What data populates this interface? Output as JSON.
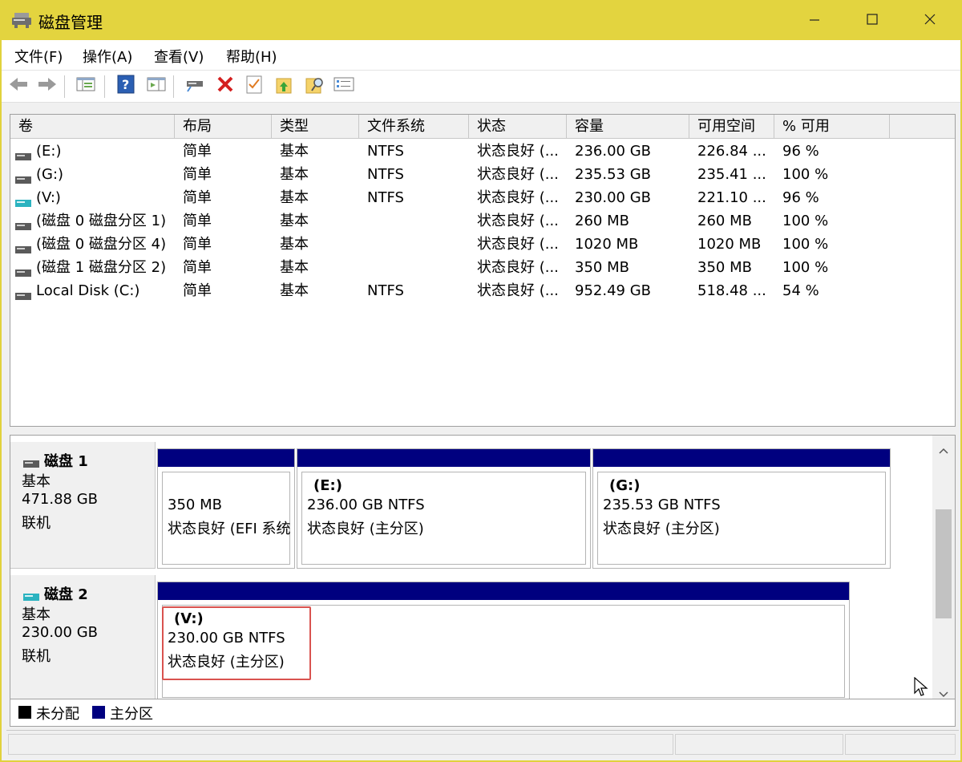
{
  "window": {
    "title": "磁盘管理",
    "icon": "disk-management-icon",
    "accent_color": "#e3d43f"
  },
  "menu": {
    "items": [
      "文件(F)",
      "操作(A)",
      "查看(V)",
      "帮助(H)"
    ]
  },
  "toolbar": {
    "buttons": [
      "back-arrow-icon",
      "forward-arrow-icon",
      "console-tree-icon",
      "help-icon",
      "action-pane-icon",
      "connect-drive-icon",
      "delete-icon",
      "checklist-icon",
      "folder-up-icon",
      "folder-search-icon",
      "properties-list-icon"
    ]
  },
  "volume_table": {
    "columns": [
      "卷",
      "布局",
      "类型",
      "文件系统",
      "状态",
      "容量",
      "可用空间",
      "% 可用"
    ],
    "rows": [
      {
        "volume": "(E:)",
        "layout": "简单",
        "type": "基本",
        "fs": "NTFS",
        "status": "状态良好 (...",
        "capacity": "236.00 GB",
        "free": "226.84 ...",
        "pct": "96 %",
        "icon": "drive-icon"
      },
      {
        "volume": "(G:)",
        "layout": "简单",
        "type": "基本",
        "fs": "NTFS",
        "status": "状态良好 (...",
        "capacity": "235.53 GB",
        "free": "235.41 ...",
        "pct": "100 %",
        "icon": "drive-icon"
      },
      {
        "volume": "(V:)",
        "layout": "简单",
        "type": "基本",
        "fs": "NTFS",
        "status": "状态良好 (...",
        "capacity": "230.00 GB",
        "free": "221.10 ...",
        "pct": "96 %",
        "icon": "usb-drive-icon"
      },
      {
        "volume": "(磁盘 0 磁盘分区 1)",
        "layout": "简单",
        "type": "基本",
        "fs": "",
        "status": "状态良好 (...",
        "capacity": "260 MB",
        "free": "260 MB",
        "pct": "100 %",
        "icon": "drive-icon"
      },
      {
        "volume": "(磁盘 0 磁盘分区 4)",
        "layout": "简单",
        "type": "基本",
        "fs": "",
        "status": "状态良好 (...",
        "capacity": "1020 MB",
        "free": "1020 MB",
        "pct": "100 %",
        "icon": "drive-icon"
      },
      {
        "volume": "(磁盘 1 磁盘分区 2)",
        "layout": "简单",
        "type": "基本",
        "fs": "",
        "status": "状态良好 (...",
        "capacity": "350 MB",
        "free": "350 MB",
        "pct": "100 %",
        "icon": "drive-icon"
      },
      {
        "volume": "Local Disk (C:)",
        "layout": "简单",
        "type": "基本",
        "fs": "NTFS",
        "status": "状态良好 (...",
        "capacity": "952.49 GB",
        "free": "518.48 ...",
        "pct": "54 %",
        "icon": "drive-icon"
      }
    ]
  },
  "disks": [
    {
      "name": "磁盘 1",
      "type": "基本",
      "size": "471.88 GB",
      "state": "联机",
      "icon": "drive-icon",
      "partitions": [
        {
          "label": "",
          "size": "350 MB",
          "status": "状态良好 (EFI 系统"
        },
        {
          "label": "(E:)",
          "size": "236.00 GB NTFS",
          "status": "状态良好 (主分区)"
        },
        {
          "label": "(G:)",
          "size": "235.53 GB NTFS",
          "status": "状态良好 (主分区)"
        }
      ]
    },
    {
      "name": "磁盘 2",
      "type": "基本",
      "size": "230.00 GB",
      "state": "联机",
      "icon": "usb-drive-icon",
      "partitions": [
        {
          "label": "(V:)",
          "size": "230.00 GB NTFS",
          "status": "状态良好 (主分区)"
        }
      ]
    }
  ],
  "legend": {
    "items": [
      {
        "label": "未分配",
        "color": "#000000"
      },
      {
        "label": "主分区",
        "color": "#00007f"
      }
    ]
  },
  "colors": {
    "primary_partition": "#00007f",
    "highlight": "#d9534f"
  }
}
